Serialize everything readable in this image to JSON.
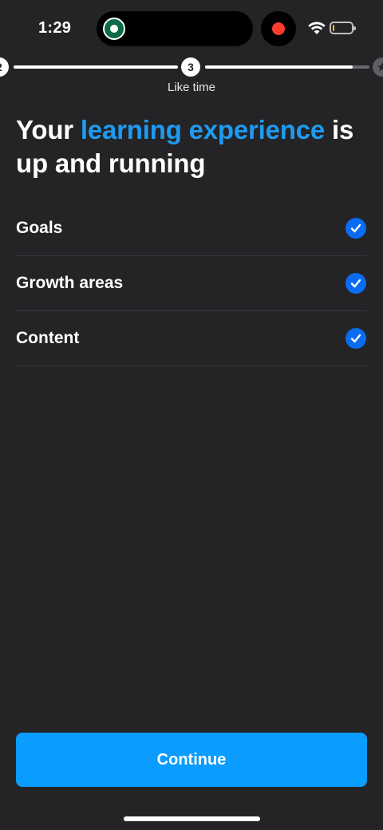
{
  "status_bar": {
    "time": "1:29",
    "island_app_icon": "starbucks-logo-icon",
    "recording_icon": "record-dot-icon",
    "wifi_icon": "wifi-icon",
    "battery_icon": "battery-low-icon",
    "battery_level": 0.1
  },
  "stepper": {
    "prev_step": "2",
    "current_step": "3",
    "current_label": "Like time",
    "progress_in_step": 0.9,
    "end_icon": "star-icon"
  },
  "headline": {
    "part1": "Your ",
    "accent": "learning experience",
    "part2": " is up and running",
    "accent_color": "#1e9bf0"
  },
  "checklist": [
    {
      "label": "Goals",
      "checked": true
    },
    {
      "label": "Growth areas",
      "checked": true
    },
    {
      "label": "Content",
      "checked": true
    }
  ],
  "check_icon": "checkmark-circle-icon",
  "check_color": "#0a6cf0",
  "continue_label": "Continue",
  "button_color": "#0a9cff"
}
